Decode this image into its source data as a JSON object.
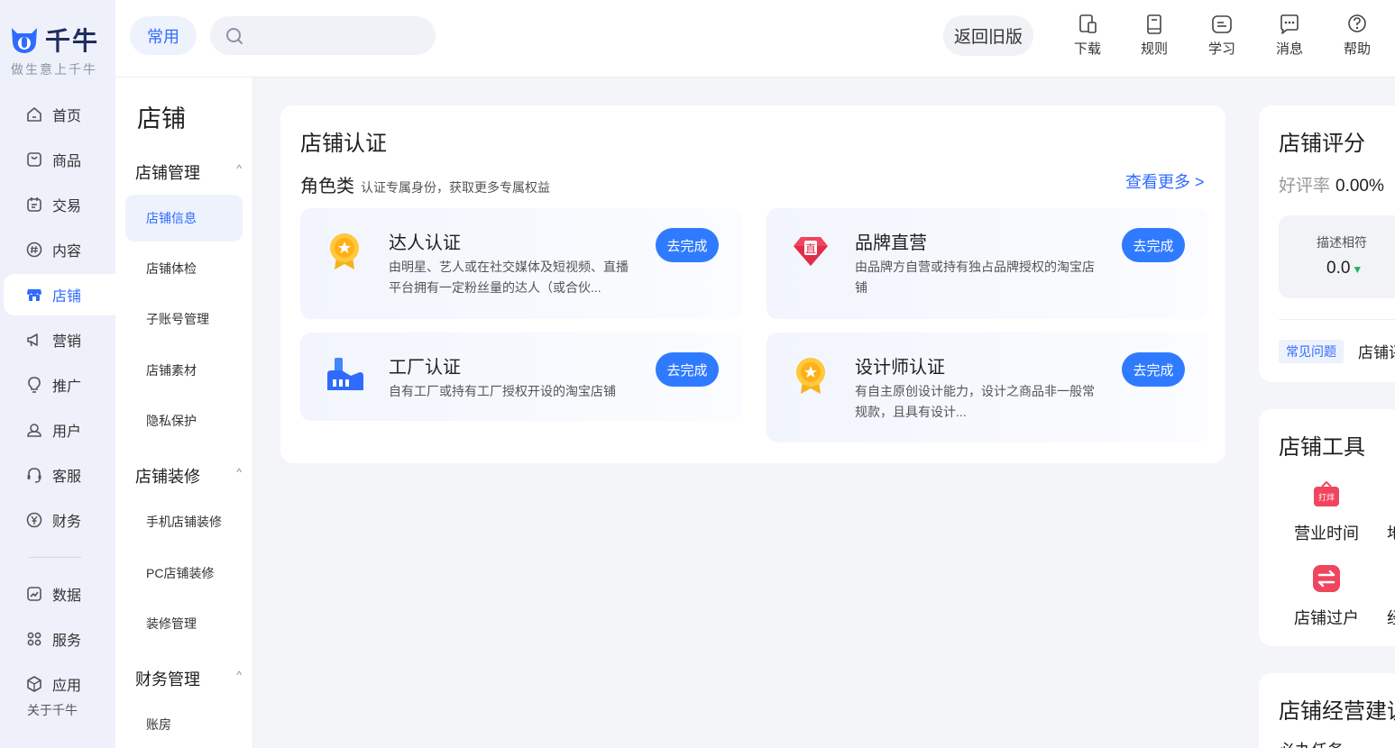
{
  "app": {
    "logo_text": "千牛",
    "slogan": "做生意上千牛",
    "about": "关于千牛"
  },
  "rail": {
    "items": [
      {
        "label": "首页",
        "icon": "home-icon"
      },
      {
        "label": "商品",
        "icon": "goods-icon"
      },
      {
        "label": "交易",
        "icon": "trade-icon"
      },
      {
        "label": "内容",
        "icon": "content-icon"
      },
      {
        "label": "店铺",
        "icon": "shop-icon"
      },
      {
        "label": "营销",
        "icon": "megaphone-icon"
      },
      {
        "label": "推广",
        "icon": "lightbulb-icon"
      },
      {
        "label": "用户",
        "icon": "user-icon"
      },
      {
        "label": "客服",
        "icon": "headset-icon"
      },
      {
        "label": "财务",
        "icon": "yuan-icon"
      },
      {
        "label": "数据",
        "icon": "chart-icon"
      },
      {
        "label": "服务",
        "icon": "grid-icon"
      },
      {
        "label": "应用",
        "icon": "box-icon"
      }
    ],
    "active_index": 4
  },
  "topbar": {
    "common": "常用",
    "search_placeholder": "",
    "old_version": "返回旧版",
    "actions": [
      {
        "label": "下载",
        "icon": "download-icon"
      },
      {
        "label": "规则",
        "icon": "book-icon"
      },
      {
        "label": "学习",
        "icon": "learn-icon"
      },
      {
        "label": "消息",
        "icon": "message-icon"
      },
      {
        "label": "帮助",
        "icon": "help-icon"
      }
    ]
  },
  "submenu": {
    "title": "店铺",
    "groups": [
      {
        "label": "店铺管理",
        "items": [
          "店铺信息",
          "店铺体检",
          "子账号管理",
          "店铺素材",
          "隐私保护"
        ]
      },
      {
        "label": "店铺装修",
        "items": [
          "手机店铺装修",
          "PC店铺装修",
          "装修管理"
        ]
      },
      {
        "label": "财务管理",
        "items": [
          "账房"
        ]
      }
    ],
    "active_item": "店铺信息"
  },
  "certification": {
    "title": "店铺认证",
    "category": "角色类",
    "category_desc": "认证专属身份，获取更多专属权益",
    "more": "查看更多 >",
    "button_label": "去完成",
    "tiles": [
      {
        "name": "达人认证",
        "desc": "由明星、艺人或在社交媒体及短视频、直播平台拥有一定粉丝量的达人（或合伙...",
        "icon": "medal-icon"
      },
      {
        "name": "品牌直营",
        "desc": "由品牌方自营或持有独占品牌授权的淘宝店铺",
        "icon": "diamond-icon"
      },
      {
        "name": "工厂认证",
        "desc": "自有工厂或持有工厂授权开设的淘宝店铺",
        "icon": "factory-icon"
      },
      {
        "name": "设计师认证",
        "desc": "有自主原创设计能力，设计之商品非一般常规款，且具有设计...",
        "icon": "medal-icon"
      }
    ]
  },
  "score": {
    "title": "店铺评分",
    "rate_label": "好评率",
    "rate_value": "0.00%",
    "desc_label": "描述相符",
    "desc_value": "0.0",
    "faq_tag": "常见问题",
    "faq_text": "店铺评"
  },
  "tools": {
    "title": "店铺工具",
    "items": [
      {
        "label": "营业时间",
        "icon": "open-sign-icon",
        "badge": "打烊"
      },
      {
        "label": "店铺过户",
        "icon": "transfer-icon"
      }
    ],
    "clipped": [
      "地",
      "经"
    ]
  },
  "advice": {
    "title": "店铺经营建议",
    "sub": "必办任务"
  },
  "colors": {
    "accent": "#2f6bff",
    "button": "#2f7bff",
    "rail_bg": "#eef1fa",
    "page_bg": "#f4f5f9"
  }
}
